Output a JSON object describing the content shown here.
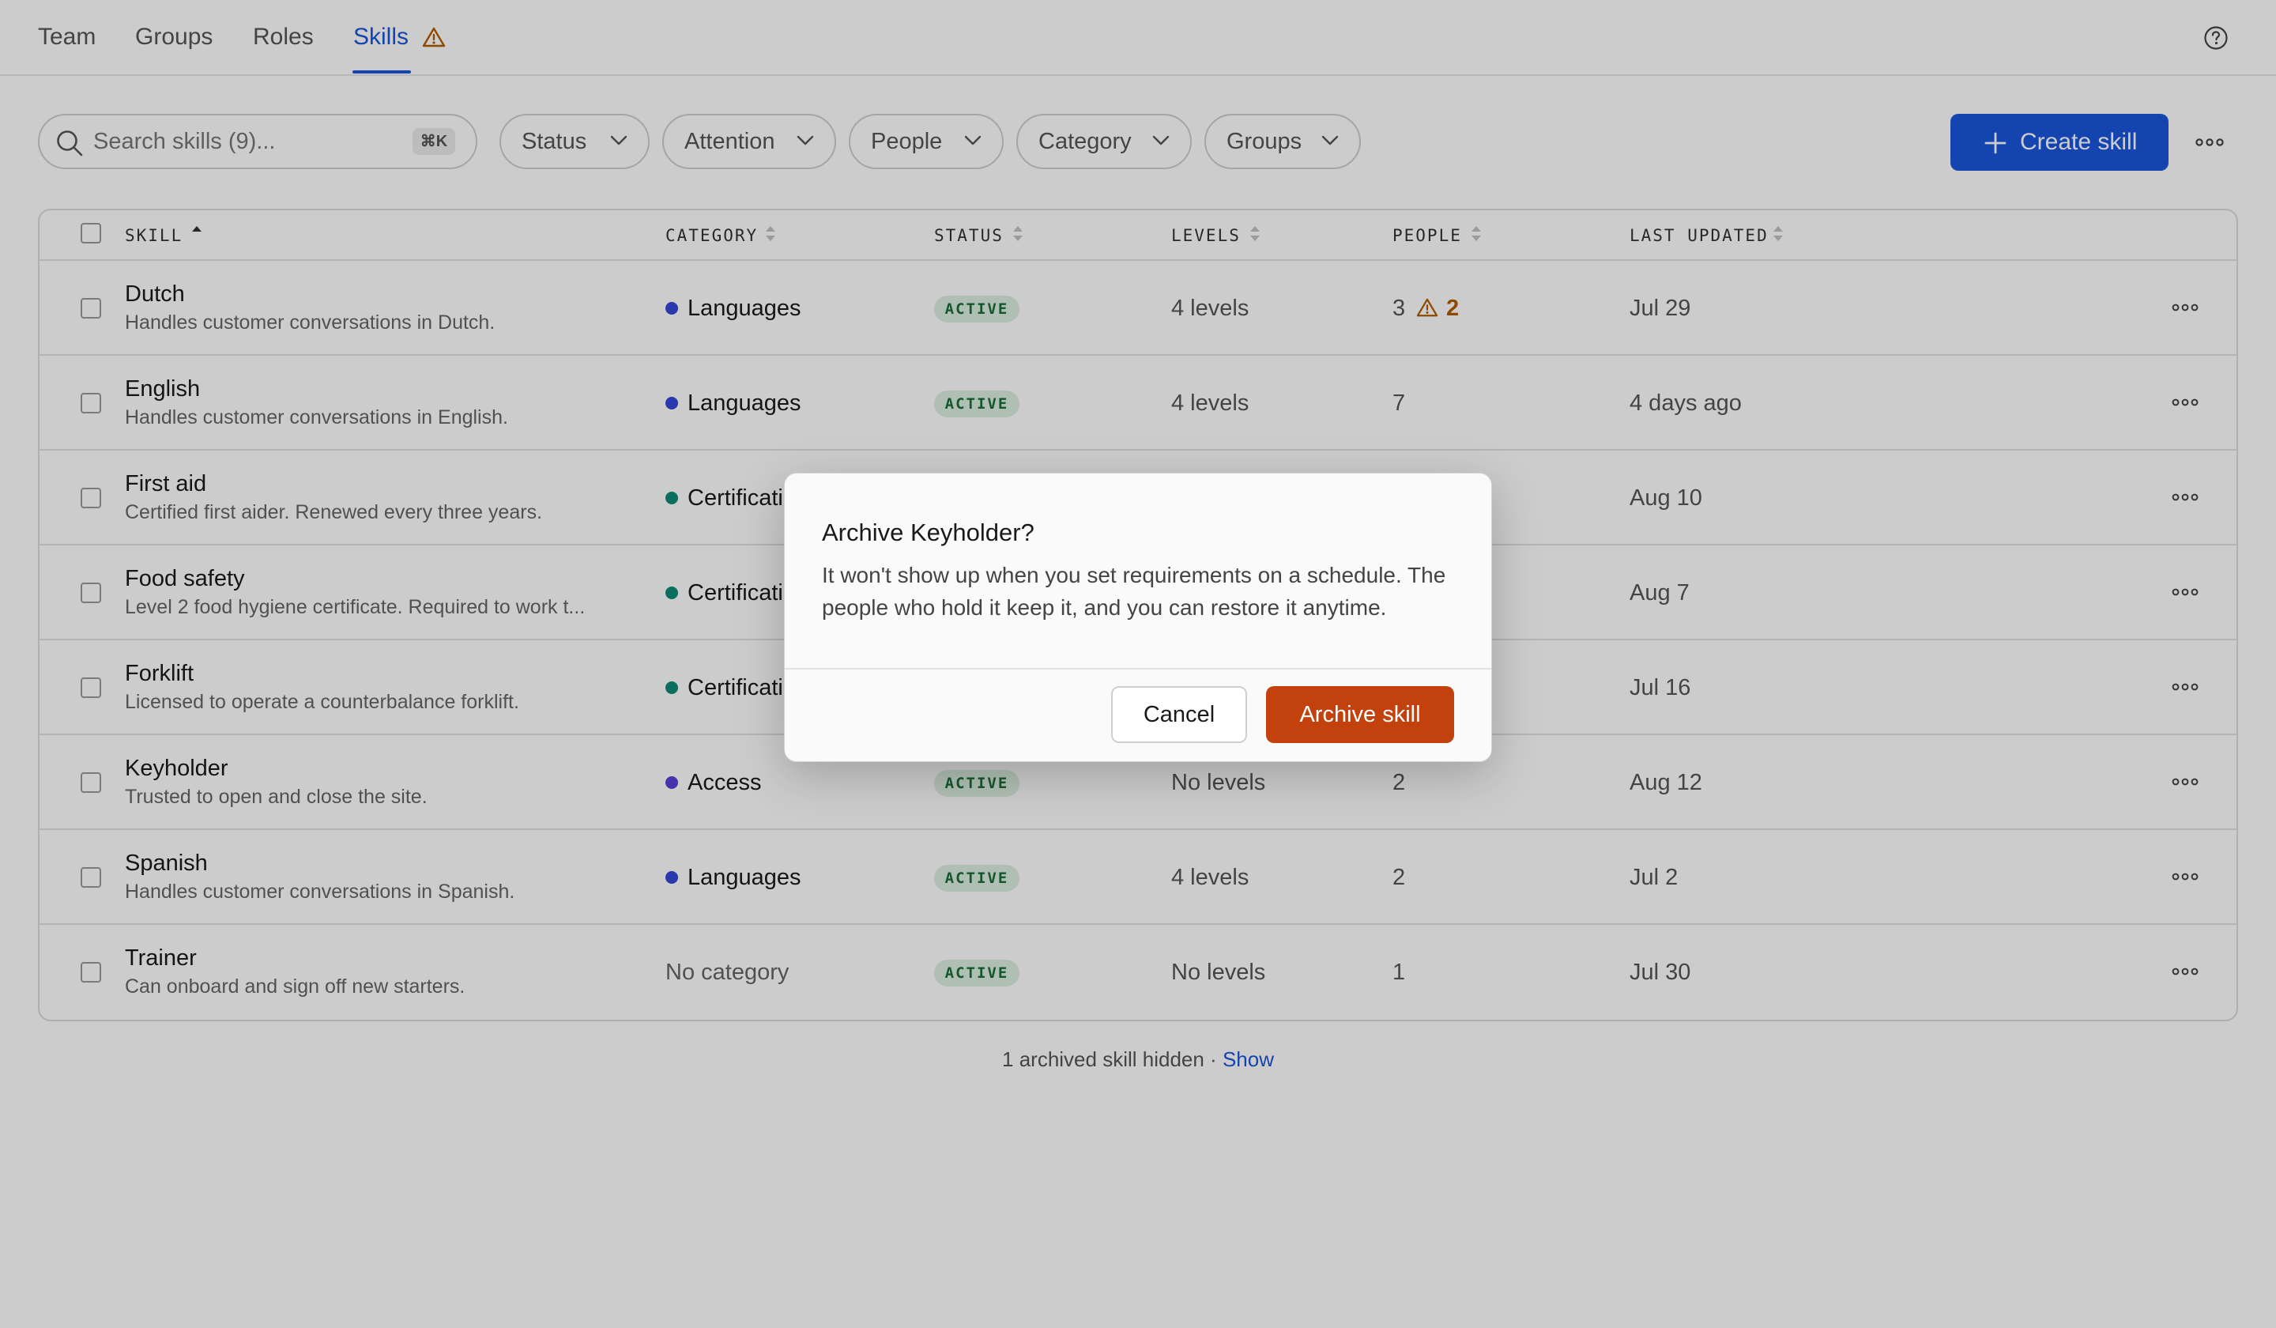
{
  "nav": {
    "tabs": [
      {
        "label": "Team"
      },
      {
        "label": "Groups"
      },
      {
        "label": "Roles"
      },
      {
        "label": "Skills",
        "active": true,
        "has_warning": true
      }
    ],
    "help_icon": "question-circle-icon"
  },
  "toolbar": {
    "search_placeholder": "Search skills (9)...",
    "search_shortcut": "⌘K",
    "filters": [
      {
        "label": "Status"
      },
      {
        "label": "Attention"
      },
      {
        "label": "People"
      },
      {
        "label": "Category"
      },
      {
        "label": "Groups"
      }
    ],
    "create_label": "Create skill"
  },
  "table": {
    "headers": {
      "skill": "SKILL",
      "category": "CATEGORY",
      "status": "STATUS",
      "levels": "LEVELS",
      "people": "PEOPLE",
      "last_updated": "LAST UPDATED"
    },
    "sorted_by": "skill-ascending",
    "rows": [
      {
        "name": "Dutch",
        "description": "Handles customer conversations in Dutch.",
        "category": "Languages",
        "category_color": "#3446d6",
        "status": "ACTIVE",
        "levels": "4 levels",
        "people": "3",
        "people_warning": "2",
        "updated": "Jul 29"
      },
      {
        "name": "English",
        "description": "Handles customer conversations in English.",
        "category": "Languages",
        "category_color": "#3446d6",
        "status": "ACTIVE",
        "levels": "4 levels",
        "people": "7",
        "updated": "4 days ago"
      },
      {
        "name": "First aid",
        "description": "Certified first aider. Renewed every three years.",
        "category": "Certificati",
        "category_color": "#0e8a73",
        "updated": "Aug 10"
      },
      {
        "name": "Food safety",
        "description": "Level 2 food hygiene certificate. Required to work t...",
        "category": "Certificati",
        "category_color": "#0e8a73",
        "updated": "Aug 7"
      },
      {
        "name": "Forklift",
        "description": "Licensed to operate a counterbalance forklift.",
        "category": "Certificati",
        "category_color": "#0e8a73",
        "updated": "Jul 16"
      },
      {
        "name": "Keyholder",
        "description": "Trusted to open and close the site.",
        "category": "Access",
        "category_color": "#5b3fd6",
        "status": "ACTIVE",
        "levels": "No levels",
        "people": "2",
        "updated": "Aug 12"
      },
      {
        "name": "Spanish",
        "description": "Handles customer conversations in Spanish.",
        "category": "Languages",
        "category_color": "#3446d6",
        "status": "ACTIVE",
        "levels": "4 levels",
        "people": "2",
        "updated": "Jul 2"
      },
      {
        "name": "Trainer",
        "description": "Can onboard and sign off new starters.",
        "category": "No category",
        "category_color": "",
        "status": "ACTIVE",
        "levels": "No levels",
        "people": "1",
        "updated": "Jul 30"
      }
    ]
  },
  "footer": {
    "note": "1 archived skill hidden · ",
    "link": "Show"
  },
  "modal": {
    "title": "Archive Keyholder?",
    "body": "It won't show up when you set requirements on a schedule. The people who hold it keep it, and you can restore it anytime.",
    "cancel_label": "Cancel",
    "confirm_label": "Archive skill",
    "confirm_color": "#c2410c"
  },
  "colors": {
    "accent": "#1a56db",
    "status_active_bg": "#dcefe1",
    "status_active_text": "#1b6d38",
    "warning": "#b25a00"
  }
}
